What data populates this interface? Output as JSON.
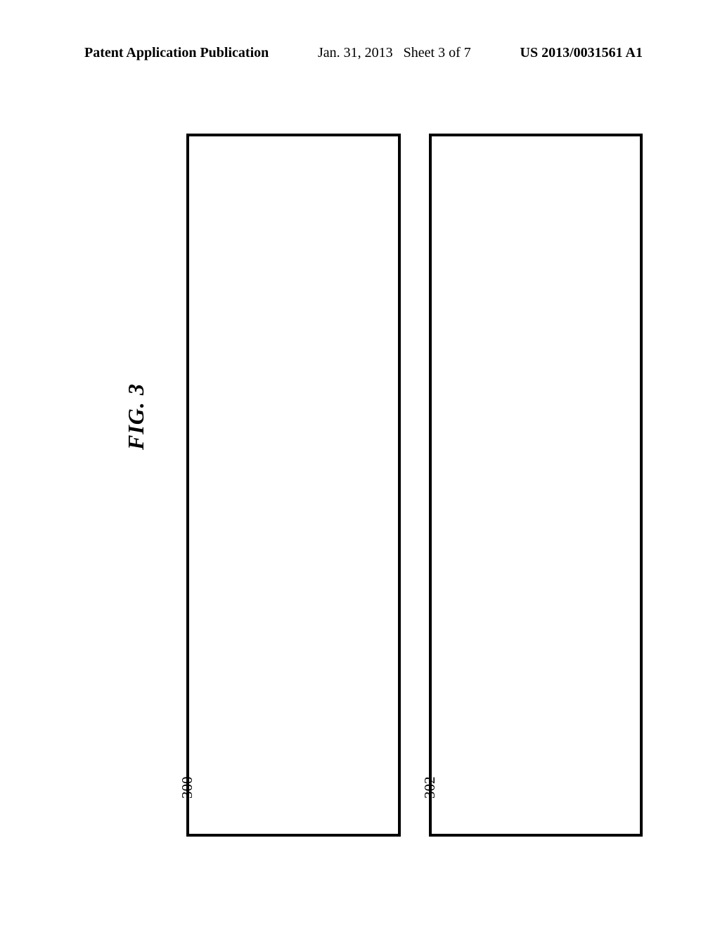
{
  "header": {
    "left": "Patent Application Publication",
    "center": "Jan. 31, 2013   Sheet 3 of 7",
    "right": "US 2013/0031561 A1"
  },
  "figure": {
    "label": "FIG.  3",
    "boxes": [
      {
        "ref": "300"
      },
      {
        "ref": "302"
      }
    ]
  }
}
